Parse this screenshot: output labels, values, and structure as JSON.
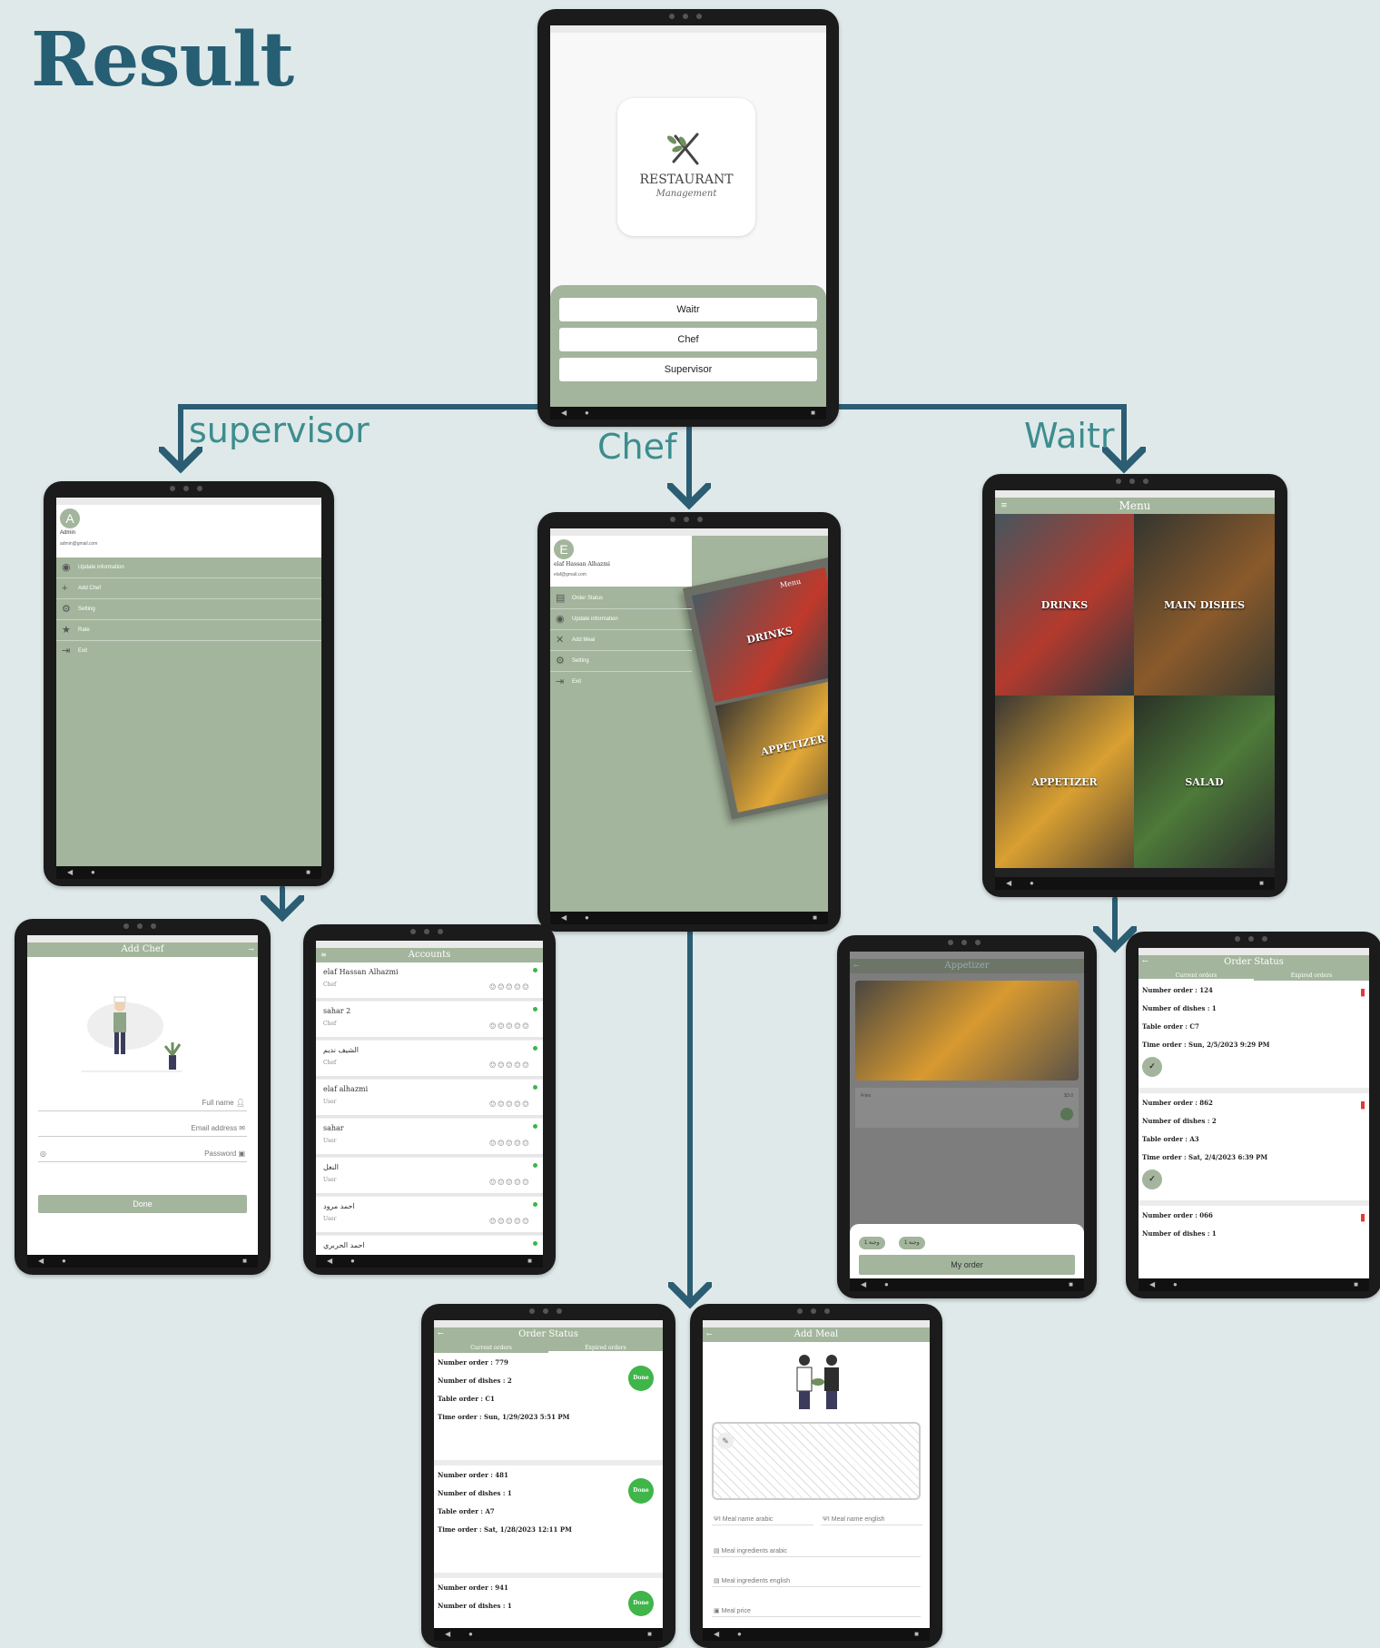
{
  "page_title": "Result",
  "branch_labels": {
    "supervisor": "supervisor",
    "chef": "Chef",
    "waitr": "Waitr"
  },
  "login": {
    "logo_title": "RESTAURANT",
    "logo_subtitle": "Management",
    "buttons": [
      "Waitr",
      "Chef",
      "Supervisor"
    ]
  },
  "supervisor_drawer": {
    "avatar_letter": "A",
    "name": "Admin",
    "email": "admin@gmail.com",
    "items": [
      "Update information",
      "Add Chef",
      "Setting",
      "Rate",
      "Exit"
    ]
  },
  "chef_drawer": {
    "avatar_letter": "E",
    "name": "elaf Hassan Alhazmi",
    "email": "elaf@gmail.com",
    "items": [
      "Order Status",
      "Update information",
      "Add Meal",
      "Setting",
      "Exit"
    ],
    "peek_title": "Menu",
    "peek_categories": [
      "DRINKS",
      "APPETIZER"
    ]
  },
  "waiter_menu": {
    "title": "Menu",
    "categories": [
      "DRINKS",
      "MAIN DISHES",
      "APPETIZER",
      "SALAD"
    ]
  },
  "add_chef": {
    "title": "Add Chef",
    "fields": [
      "Full name",
      "Email address",
      "Password"
    ],
    "done": "Done"
  },
  "accounts": {
    "title": "Accounts",
    "rows": [
      {
        "name": "elaf Hassan Alhazmi",
        "role": "Chef"
      },
      {
        "name": "sahar 2",
        "role": "Chef"
      },
      {
        "name": "الشيف نديم",
        "role": "Chef"
      },
      {
        "name": "elaf alhazmi",
        "role": "User"
      },
      {
        "name": "sahar",
        "role": "User"
      },
      {
        "name": "النغل",
        "role": "User"
      },
      {
        "name": "احمد مرود",
        "role": "User"
      },
      {
        "name": "احمد الحربري",
        "role": ""
      }
    ]
  },
  "appetizer": {
    "title": "Appetizer",
    "item_name": "Fries",
    "item_price": "$3.0",
    "chips": [
      "1 وجبة",
      "1 وجبة"
    ],
    "button": "My order"
  },
  "waiter_orders": {
    "title": "Order Status",
    "tabs": [
      "Current orders",
      "Expired orders"
    ],
    "orders": [
      {
        "number": "Number order : 124",
        "dishes": "Number of dishes : 1",
        "table": "Table order : C7",
        "time": "Time order : Sun, 2/5/2023 9:29 PM"
      },
      {
        "number": "Number order : 862",
        "dishes": "Number of dishes : 2",
        "table": "Table order : A3",
        "time": "Time order : Sat, 2/4/2023 6:39 PM"
      },
      {
        "number": "Number order : 066",
        "dishes": "Number of dishes : 1",
        "table": "",
        "time": ""
      }
    ]
  },
  "chef_orders": {
    "title": "Order Status",
    "tabs": [
      "Current orders",
      "Expired orders"
    ],
    "done_label": "Done",
    "orders": [
      {
        "number": "Number order : 779",
        "dishes": "Number of dishes : 2",
        "table": "Table order : C1",
        "time": "Time order : Sun, 1/29/2023 5:51 PM"
      },
      {
        "number": "Number order : 481",
        "dishes": "Number of dishes : 1",
        "table": "Table order : A7",
        "time": "Time order : Sat, 1/28/2023 12:11 PM"
      },
      {
        "number": "Number order : 941",
        "dishes": "Number of dishes : 1",
        "table": "",
        "time": ""
      }
    ]
  },
  "add_meal": {
    "title": "Add Meal",
    "fields": [
      "Meal name arabic",
      "Meal name english",
      "Meal ingredients arabic",
      "Meal ingredients english",
      "Meal price"
    ]
  },
  "nav_symbols": [
    "◀",
    "●",
    "■"
  ],
  "icons": {
    "back": "back-arrow-icon",
    "hamburger": "hamburger-icon",
    "delete": "trash-icon",
    "check": "check-icon"
  },
  "colors": {
    "sage": "#a3b59c",
    "title": "#265e73",
    "arrow": "#2b5d73",
    "label": "#3d8d8e",
    "done_green": "#3fb54a",
    "delete_red": "#e53935"
  }
}
